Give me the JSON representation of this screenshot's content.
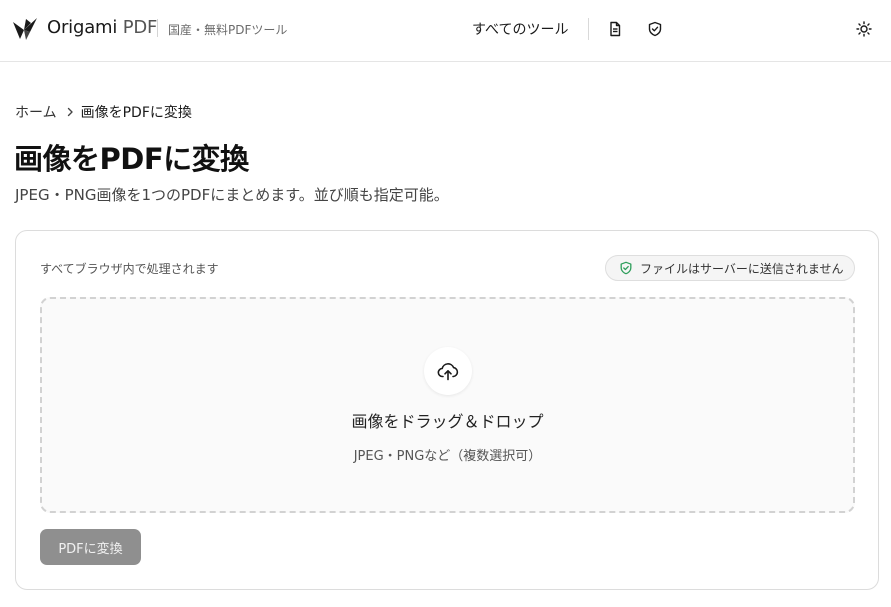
{
  "header": {
    "logo_name": "Origami",
    "logo_suffix": "PDF",
    "tagline": "国産・無料PDFツール",
    "nav_all_tools": "すべてのツール",
    "icons": [
      "document-icon",
      "shield-check-icon",
      "sun-icon"
    ]
  },
  "breadcrumb": {
    "home": "ホーム",
    "current": "画像をPDFに変換"
  },
  "page": {
    "title": "画像をPDFに変換",
    "description": "JPEG・PNG画像を1つのPDFにまとめます。並び順も指定可能。"
  },
  "card": {
    "note": "すべてブラウザ内で処理されます",
    "privacy_badge": "ファイルはサーバーに送信されません",
    "dropzone": {
      "title": "画像をドラッグ＆ドロップ",
      "subtitle": "JPEG・PNGなど（複数選択可）"
    },
    "convert_button": "PDFに変換"
  },
  "colors": {
    "accent_green": "#2e9e5b",
    "button_disabled": "#8f8f8f",
    "border": "#dcdcdc"
  }
}
